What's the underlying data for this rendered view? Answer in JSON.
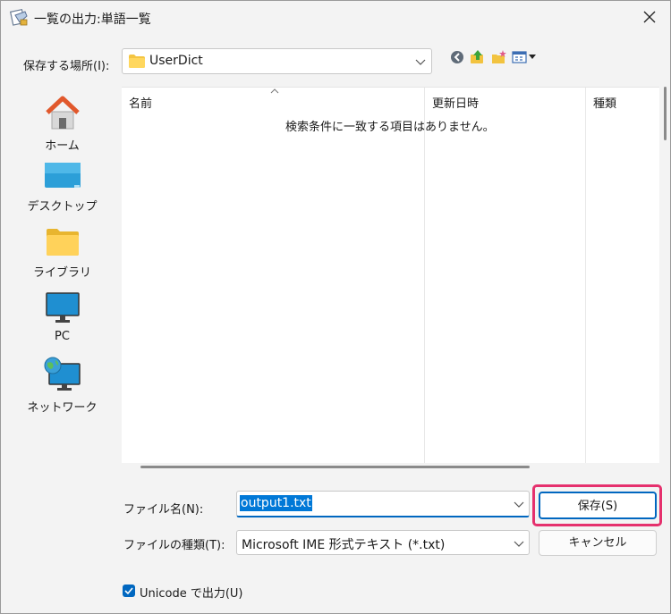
{
  "window": {
    "title": "一覧の出力:単語一覧"
  },
  "location": {
    "label": "保存する場所(I):",
    "value": "UserDict"
  },
  "toolbar": {
    "icons": [
      "back-icon",
      "up-folder-icon",
      "new-folder-icon",
      "view-menu-icon"
    ]
  },
  "places": [
    {
      "label": "ホーム",
      "icon": "home-icon"
    },
    {
      "label": "デスクトップ",
      "icon": "desktop-icon"
    },
    {
      "label": "ライブラリ",
      "icon": "library-folder-icon"
    },
    {
      "label": "PC",
      "icon": "pc-icon"
    },
    {
      "label": "ネットワーク",
      "icon": "network-icon"
    }
  ],
  "file_list": {
    "columns": [
      "名前",
      "更新日時",
      "種類"
    ],
    "empty_message": "検索条件に一致する項目はありません。"
  },
  "filename": {
    "label": "ファイル名(N):",
    "value": "output1.txt"
  },
  "filetype": {
    "label": "ファイルの種類(T):",
    "value": "Microsoft IME 形式テキスト (*.txt)"
  },
  "buttons": {
    "save": "保存(S)",
    "cancel": "キャンセル"
  },
  "unicode_option": {
    "label": "Unicode で出力(U)",
    "checked": true
  },
  "colors": {
    "accent": "#0067c0",
    "highlight": "#e5306d",
    "selection": "#0078d7"
  }
}
